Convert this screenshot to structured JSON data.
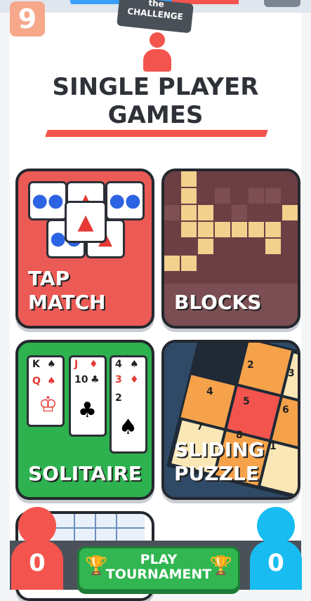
{
  "header": {
    "level_badge": "9",
    "tag_line1": "the",
    "tag_line2": "CHALLENGE",
    "title_line1": "SINGLE PLAYER",
    "title_line2": "GAMES"
  },
  "games": [
    {
      "label_line1": "TAP",
      "label_line2": "MATCH"
    },
    {
      "label_line1": "BLOCKS",
      "label_line2": ""
    },
    {
      "label_line1": "SOLITAIRE",
      "label_line2": ""
    },
    {
      "label_line1": "SLIDING",
      "label_line2": "PUZZLE"
    }
  ],
  "solitaire": {
    "cards": [
      "K",
      "Q",
      "J",
      "10",
      "4",
      "3",
      "2"
    ]
  },
  "sliding": {
    "numbers": [
      "2",
      "3",
      "4",
      "5",
      "6",
      "7",
      "8",
      "1"
    ]
  },
  "footer": {
    "left_score": "0",
    "right_score": "0",
    "play_line1": "PLAY",
    "play_line2": "TOURNAMENT"
  },
  "colors": {
    "red": "#f4544e",
    "blue": "#19bcf0",
    "green": "#31b651",
    "dark": "#2e3238"
  }
}
